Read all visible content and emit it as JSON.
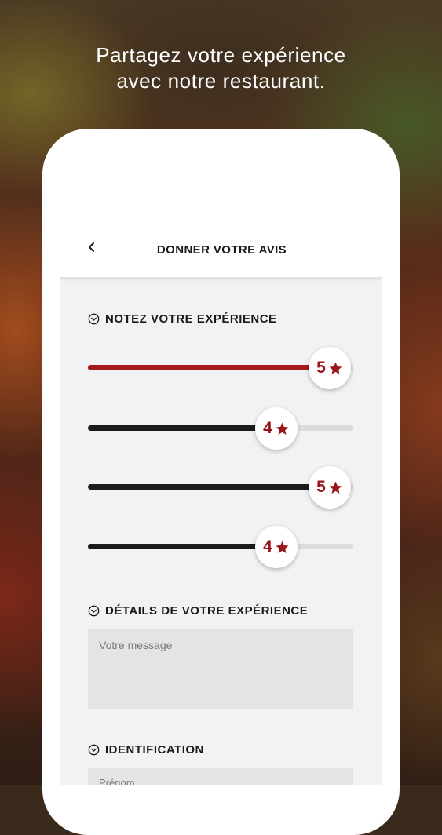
{
  "headline": {
    "line1": "Partagez votre expérience",
    "line2": "avec notre restaurant."
  },
  "appbar": {
    "back_icon": "chevron-left-icon",
    "title": "DONNER VOTRE AVIS"
  },
  "rating_section": {
    "icon": "chevron-down-circle-icon",
    "title": "NOTEZ VOTRE EXPÉRIENCE",
    "scale_max": 5,
    "sliders": [
      {
        "value": 5,
        "label": "5",
        "active": true
      },
      {
        "value": 4,
        "label": "4",
        "active": false
      },
      {
        "value": 5,
        "label": "5",
        "active": false
      },
      {
        "value": 4,
        "label": "4",
        "active": false
      }
    ]
  },
  "details_section": {
    "icon": "chevron-down-circle-icon",
    "title": "DÉTAILS DE VOTRE EXPÉRIENCE",
    "message_placeholder": "Votre message"
  },
  "identification_section": {
    "icon": "chevron-down-circle-icon",
    "title": "IDENTIFICATION",
    "firstname_placeholder": "Prénom"
  },
  "colors": {
    "accent": "#a51a1c",
    "star": "#9a1519",
    "track_fill": "#1b1b1b",
    "track_empty": "#dcdcdc",
    "screen_bg": "#f2f2f4"
  }
}
